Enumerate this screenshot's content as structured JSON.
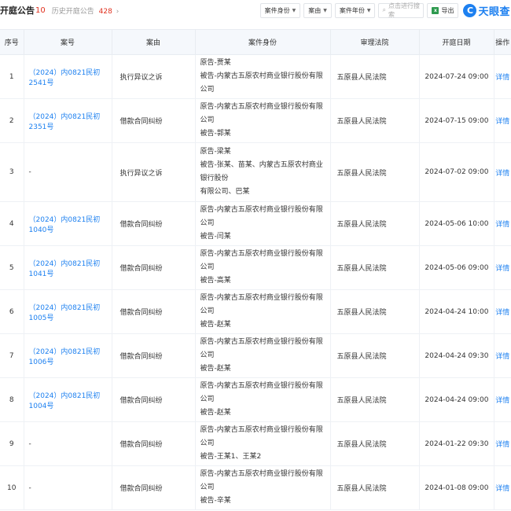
{
  "header": {
    "title": "开庭公告",
    "count": "10",
    "history_label": "历史开庭公告",
    "history_count": "428",
    "history_arrow": "›"
  },
  "toolbar": {
    "filter_role": "案件身份",
    "filter_cause": "案由",
    "filter_year": "案件年份",
    "search_placeholder": "点击进行搜索",
    "export_label": "导出",
    "logo_mark": "C",
    "logo_text": "天眼查"
  },
  "table": {
    "columns": [
      "序号",
      "案号",
      "案由",
      "案件身份",
      "审理法院",
      "开庭日期",
      "操作"
    ],
    "rows": [
      {
        "idx": "1",
        "case_no": "（2024）内0821民初2541号",
        "cause": "执行异议之诉",
        "parties": [
          "原告-贾某",
          "被告-内蒙古五原农村商业银行股份有限公司"
        ],
        "court": "五原县人民法院",
        "date": "2024-07-24 09:00",
        "action": "详情"
      },
      {
        "idx": "2",
        "case_no": "（2024）内0821民初2351号",
        "cause": "借款合同纠纷",
        "parties": [
          "原告-内蒙古五原农村商业银行股份有限公司",
          "被告-郭某"
        ],
        "court": "五原县人民法院",
        "date": "2024-07-15 09:00",
        "action": "详情"
      },
      {
        "idx": "3",
        "case_no": "-",
        "cause": "执行异议之诉",
        "parties": [
          "原告-梁某",
          "被告-张某、苗某、内蒙古五原农村商业银行股份",
          "有限公司、巴某"
        ],
        "court": "五原县人民法院",
        "date": "2024-07-02 09:00",
        "action": "详情"
      },
      {
        "idx": "4",
        "case_no": "（2024）内0821民初1040号",
        "cause": "借款合同纠纷",
        "parties": [
          "原告-内蒙古五原农村商业银行股份有限公司",
          "被告-闫某"
        ],
        "court": "五原县人民法院",
        "date": "2024-05-06 10:00",
        "action": "详情"
      },
      {
        "idx": "5",
        "case_no": "（2024）内0821民初1041号",
        "cause": "借款合同纠纷",
        "parties": [
          "原告-内蒙古五原农村商业银行股份有限公司",
          "被告-高某"
        ],
        "court": "五原县人民法院",
        "date": "2024-05-06 09:00",
        "action": "详情"
      },
      {
        "idx": "6",
        "case_no": "（2024）内0821民初1005号",
        "cause": "借款合同纠纷",
        "parties": [
          "原告-内蒙古五原农村商业银行股份有限公司",
          "被告-赵某"
        ],
        "court": "五原县人民法院",
        "date": "2024-04-24 10:00",
        "action": "详情"
      },
      {
        "idx": "7",
        "case_no": "（2024）内0821民初1006号",
        "cause": "借款合同纠纷",
        "parties": [
          "原告-内蒙古五原农村商业银行股份有限公司",
          "被告-赵某"
        ],
        "court": "五原县人民法院",
        "date": "2024-04-24 09:30",
        "action": "详情"
      },
      {
        "idx": "8",
        "case_no": "（2024）内0821民初1004号",
        "cause": "借款合同纠纷",
        "parties": [
          "原告-内蒙古五原农村商业银行股份有限公司",
          "被告-赵某"
        ],
        "court": "五原县人民法院",
        "date": "2024-04-24 09:00",
        "action": "详情"
      },
      {
        "idx": "9",
        "case_no": "-",
        "cause": "借款合同纠纷",
        "parties": [
          "原告-内蒙古五原农村商业银行股份有限公司",
          "被告-王某1、王某2"
        ],
        "court": "五原县人民法院",
        "date": "2024-01-22 09:30",
        "action": "详情"
      },
      {
        "idx": "10",
        "case_no": "-",
        "cause": "借款合同纠纷",
        "parties": [
          "原告-内蒙古五原农村商业银行股份有限公司",
          "被告-辛某"
        ],
        "court": "五原县人民法院",
        "date": "2024-01-08 09:00",
        "action": "详情"
      }
    ]
  },
  "colors": {
    "link": "#1d80f0",
    "accent_red": "#e0301e",
    "header_bg": "#f5f8fc"
  }
}
